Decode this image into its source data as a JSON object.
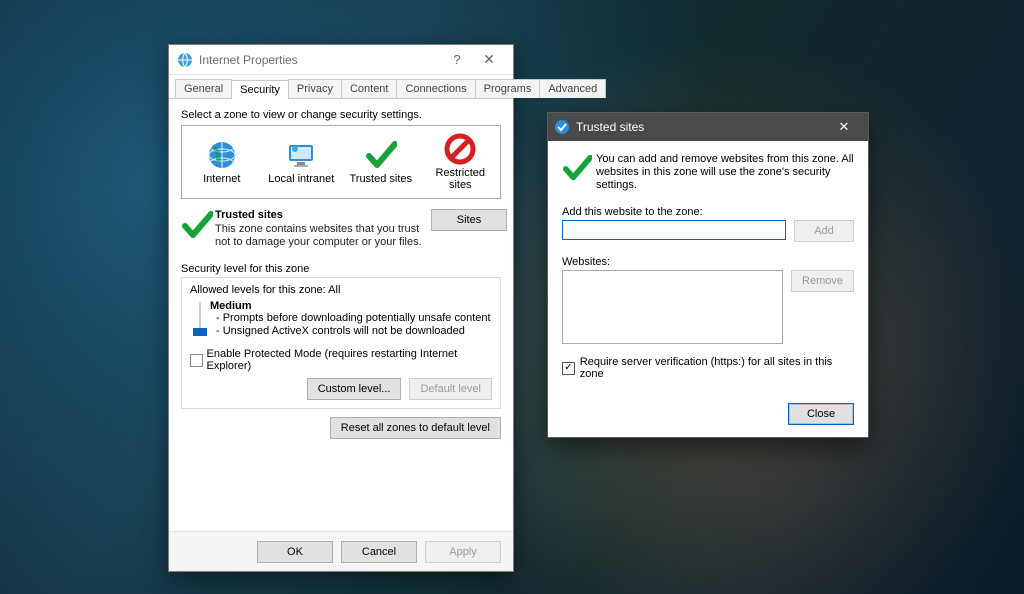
{
  "props": {
    "title": "Internet Properties",
    "tabs": [
      "General",
      "Security",
      "Privacy",
      "Content",
      "Connections",
      "Programs",
      "Advanced"
    ],
    "active_tab": "Security",
    "zone_label": "Select a zone to view or change security settings.",
    "zones": [
      {
        "name": "Internet",
        "icon": "globe-icon"
      },
      {
        "name": "Local intranet",
        "icon": "monitor-icon"
      },
      {
        "name": "Trusted sites",
        "icon": "check-icon"
      },
      {
        "name": "Restricted sites",
        "icon": "nosign-icon"
      }
    ],
    "selected_zone_title": "Trusted sites",
    "selected_zone_desc": "This zone contains websites that you trust not to damage your computer or your files.",
    "sites_btn": "Sites",
    "group_title": "Security level for this zone",
    "allowed": "Allowed levels for this zone: All",
    "level": "Medium",
    "level_bullets": [
      "- Prompts before downloading potentially unsafe content",
      "- Unsigned ActiveX controls will not be downloaded"
    ],
    "protected_mode": "Enable Protected Mode (requires restarting Internet Explorer)",
    "btn_custom": "Custom level...",
    "btn_default_level": "Default level",
    "btn_reset": "Reset all zones to default level",
    "footer": {
      "ok": "OK",
      "cancel": "Cancel",
      "apply": "Apply"
    }
  },
  "trusted": {
    "title": "Trusted sites",
    "intro": "You can add and remove websites from this zone. All websites in this zone will use the zone's security settings.",
    "add_label": "Add this website to the zone:",
    "add_value": "",
    "add_btn": "Add",
    "websites_label": "Websites:",
    "remove_btn": "Remove",
    "require_https": "Require server verification (https:) for all sites in this zone",
    "require_https_checked": true,
    "close_btn": "Close"
  }
}
